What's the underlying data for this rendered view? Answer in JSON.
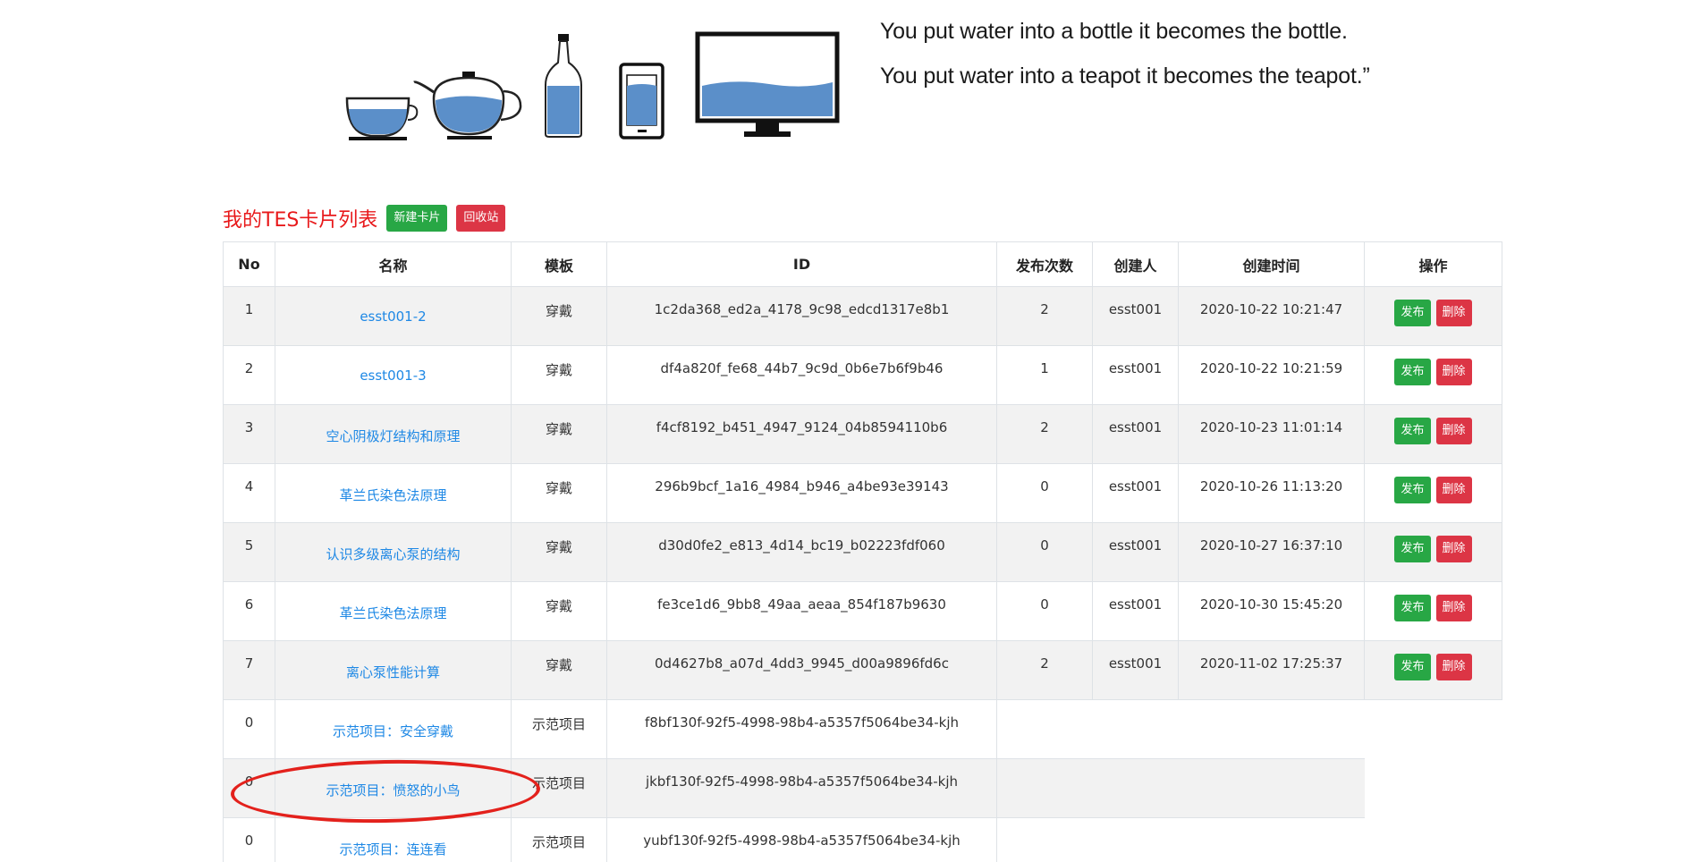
{
  "quote": {
    "line1": "You put water into a bottle it becomes the bottle.",
    "line2": "You put water into a teapot it becomes the teapot.”"
  },
  "header": {
    "title": "我的TES卡片列表",
    "new_button": "新建卡片",
    "recycle_button": "回收站"
  },
  "table": {
    "columns": [
      "No",
      "名称",
      "模板",
      "ID",
      "发布次数",
      "创建人",
      "创建时间",
      "操作"
    ],
    "rows": [
      {
        "no": "1",
        "name": "esst001-2",
        "template": "穿戴",
        "id": "1c2da368_ed2a_4178_9c98_edcd1317e8b1",
        "count": "2",
        "creator": "esst001",
        "time": "2020-10-22 10:21:47"
      },
      {
        "no": "2",
        "name": "esst001-3",
        "template": "穿戴",
        "id": "df4a820f_fe68_44b7_9c9d_0b6e7b6f9b46",
        "count": "1",
        "creator": "esst001",
        "time": "2020-10-22 10:21:59"
      },
      {
        "no": "3",
        "name": "空心阴极灯结构和原理",
        "template": "穿戴",
        "id": "f4cf8192_b451_4947_9124_04b8594110b6",
        "count": "2",
        "creator": "esst001",
        "time": "2020-10-23 11:01:14"
      },
      {
        "no": "4",
        "name": "革兰氏染色法原理",
        "template": "穿戴",
        "id": "296b9bcf_1a16_4984_b946_a4be93e39143",
        "count": "0",
        "creator": "esst001",
        "time": "2020-10-26 11:13:20"
      },
      {
        "no": "5",
        "name": "认识多级离心泵的结构",
        "template": "穿戴",
        "id": "d30d0fe2_e813_4d14_bc19_b02223fdf060",
        "count": "0",
        "creator": "esst001",
        "time": "2020-10-27 16:37:10"
      },
      {
        "no": "6",
        "name": "革兰氏染色法原理",
        "template": "穿戴",
        "id": "fe3ce1d6_9bb8_49aa_aeaa_854f187b9630",
        "count": "0",
        "creator": "esst001",
        "time": "2020-10-30 15:45:20"
      },
      {
        "no": "7",
        "name": "离心泵性能计算",
        "template": "穿戴",
        "id": "0d4627b8_a07d_4dd3_9945_d00a9896fd6c",
        "count": "2",
        "creator": "esst001",
        "time": "2020-11-02 17:25:37"
      }
    ],
    "demo_rows": [
      {
        "no": "0",
        "name": "示范项目：安全穿戴",
        "template": "示范项目",
        "id": "f8bf130f-92f5-4998-98b4-a5357f5064be34-kjh"
      },
      {
        "no": "0",
        "name": "示范项目：愤怒的小鸟",
        "template": "示范项目",
        "id": "jkbf130f-92f5-4998-98b4-a5357f5064be34-kjh"
      },
      {
        "no": "0",
        "name": "示范项目：连连看",
        "template": "示范项目",
        "id": "yubf130f-92f5-4998-98b4-a5357f5064be34-kjh"
      }
    ],
    "publish_label": "发布",
    "delete_label": "删除"
  },
  "colors": {
    "title_red": "#e8191b",
    "button_green": "#28a745",
    "button_red": "#dc3545",
    "link_blue": "#1e88e5",
    "water_blue": "#5b8fc9",
    "annotation_circle": "#e3211c"
  }
}
